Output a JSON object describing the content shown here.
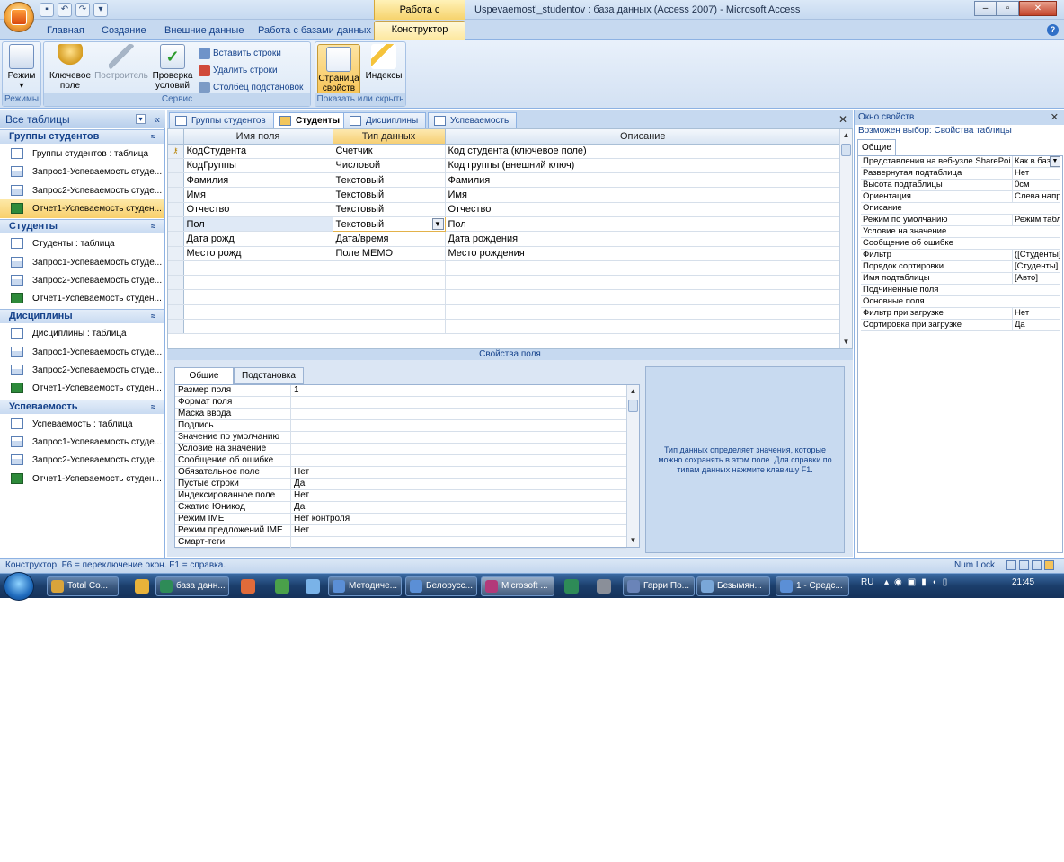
{
  "title": {
    "context_tab": "Работа с таблицами",
    "window": "Uspevaemost'_studentov : база данных (Access 2007)  -  Microsoft Access"
  },
  "ribbon_tabs": [
    "Главная",
    "Создание",
    "Внешние данные",
    "Работа с базами данных",
    "Конструктор"
  ],
  "ribbon": {
    "groups": [
      "Режимы",
      "Сервис",
      "Показать или скрыть"
    ],
    "mode": "Режим",
    "key": [
      "Ключевое",
      "поле"
    ],
    "builder": "Построитель",
    "check": [
      "Проверка",
      "условий"
    ],
    "insert_rows": "Вставить строки",
    "delete_rows": "Удалить строки",
    "lookup_col": "Столбец  подстановок",
    "prop_sheet": [
      "Страница",
      "свойств"
    ],
    "indexes": "Индексы"
  },
  "nav": {
    "title": "Все таблицы",
    "groups": [
      {
        "name": "Группы студентов",
        "items": [
          {
            "label": "Группы студентов : таблица",
            "kind": "table"
          },
          {
            "label": "Запрос1-Успеваемость студе...",
            "kind": "query"
          },
          {
            "label": "Запрос2-Успеваемость студе...",
            "kind": "query"
          },
          {
            "label": "Отчет1-Успеваемость студен...",
            "kind": "report"
          }
        ]
      },
      {
        "name": "Студенты",
        "items": [
          {
            "label": "Студенты : таблица",
            "kind": "table"
          },
          {
            "label": "Запрос1-Успеваемость студе...",
            "kind": "query"
          },
          {
            "label": "Запрос2-Успеваемость студе...",
            "kind": "query"
          },
          {
            "label": "Отчет1-Успеваемость студен...",
            "kind": "report"
          }
        ]
      },
      {
        "name": "Дисциплины",
        "items": [
          {
            "label": "Дисциплины : таблица",
            "kind": "table"
          },
          {
            "label": "Запрос1-Успеваемость студе...",
            "kind": "query"
          },
          {
            "label": "Запрос2-Успеваемость студе...",
            "kind": "query"
          },
          {
            "label": "Отчет1-Успеваемость студен...",
            "kind": "report"
          }
        ]
      },
      {
        "name": "Успеваемость",
        "items": [
          {
            "label": "Успеваемость : таблица",
            "kind": "table"
          },
          {
            "label": "Запрос1-Успеваемость студе...",
            "kind": "query"
          },
          {
            "label": "Запрос2-Успеваемость студе...",
            "kind": "query"
          },
          {
            "label": "Отчет1-Успеваемость студен...",
            "kind": "report"
          }
        ]
      }
    ]
  },
  "doc_tabs": [
    "Группы студентов",
    "Студенты",
    "Дисциплины",
    "Успеваемость"
  ],
  "design": {
    "headers": [
      "Имя поля",
      "Тип данных",
      "Описание"
    ],
    "rows": [
      [
        "КодСтудента",
        "Счетчик",
        "Код студента (ключевое поле)"
      ],
      [
        "КодГруппы",
        "Числовой",
        "Код группы (внешний ключ)"
      ],
      [
        "Фамилия",
        "Текстовый",
        "Фамилия"
      ],
      [
        "Имя",
        "Текстовый",
        "Имя"
      ],
      [
        "Отчество",
        "Текстовый",
        "Отчество"
      ],
      [
        "Пол",
        "Текстовый",
        "Пол"
      ],
      [
        "Дата рожд",
        "Дата/время",
        "Дата рождения"
      ],
      [
        "Место рожд",
        "Поле MEMO",
        "Место рождения"
      ]
    ]
  },
  "field_props": {
    "title": "Свойства поля",
    "tabs": [
      "Общие",
      "Подстановка"
    ],
    "rows": [
      [
        "Размер поля",
        "1"
      ],
      [
        "Формат поля",
        ""
      ],
      [
        "Маска ввода",
        ""
      ],
      [
        "Подпись",
        ""
      ],
      [
        "Значение по умолчанию",
        ""
      ],
      [
        "Условие на значение",
        ""
      ],
      [
        "Сообщение об ошибке",
        ""
      ],
      [
        "Обязательное поле",
        "Нет"
      ],
      [
        "Пустые строки",
        "Да"
      ],
      [
        "Индексированное поле",
        "Нет"
      ],
      [
        "Сжатие Юникод",
        "Да"
      ],
      [
        "Режим IME",
        "Нет контроля"
      ],
      [
        "Режим предложений IME",
        "Нет"
      ],
      [
        "Смарт-теги",
        ""
      ]
    ],
    "help": "Тип данных определяет значения, которые можно сохранять в этом поле.  Для справки по типам данных нажмите клавишу F1."
  },
  "props": {
    "title": "Окно свойств",
    "selection": "Возможен выбор:  Свойства таблицы",
    "tab": "Общие",
    "rows": [
      [
        "Представления на веб-узле SharePoint",
        "Как в базе"
      ],
      [
        "Развернутая подтаблица",
        "Нет"
      ],
      [
        "Высота подтаблицы",
        "0см"
      ],
      [
        "Ориентация",
        "Слева направо"
      ],
      [
        "Описание",
        ""
      ],
      [
        "Режим по умолчанию",
        "Режим табл"
      ],
      [
        "Условие на значение",
        ""
      ],
      [
        "Сообщение об ошибке",
        ""
      ],
      [
        "Фильтр",
        "([Студенты]"
      ],
      [
        "Порядок сортировки",
        "[Студенты]."
      ],
      [
        "Имя подтаблицы",
        "[Авто]"
      ],
      [
        "Подчиненные поля",
        ""
      ],
      [
        "Основные поля",
        ""
      ],
      [
        "Фильтр при загрузке",
        "Нет"
      ],
      [
        "Сортировка при загрузке",
        "Да"
      ]
    ]
  },
  "status": {
    "left": "Конструктор.  F6 = переключение окон.  F1 = справка.",
    "numlock": "Num Lock"
  },
  "taskbar": {
    "items": [
      "Total Co...",
      "база данн...",
      "Методиче...",
      "Белорусс...",
      "Microsoft ...",
      "Гарри По...",
      "Безымян...",
      "1 - Средс..."
    ],
    "lang": "RU",
    "time": "21:45"
  }
}
